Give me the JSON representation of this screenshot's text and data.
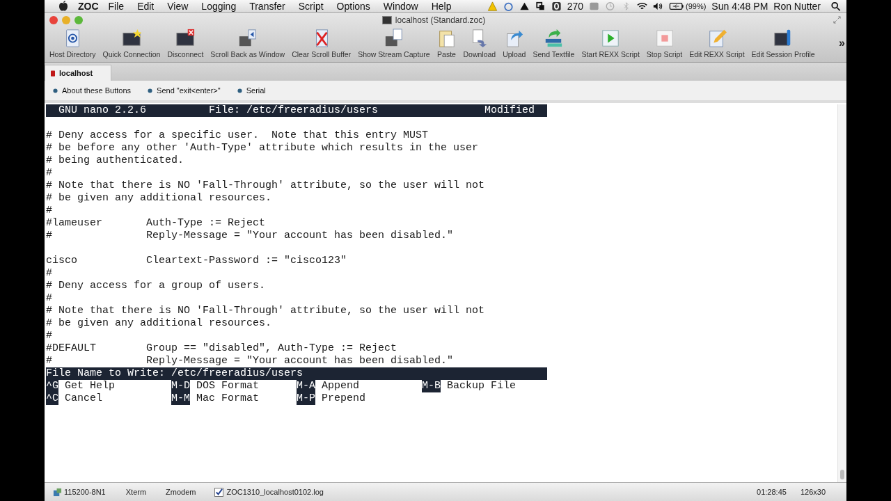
{
  "menu_bar": {
    "app": "ZOC",
    "menus": [
      "File",
      "Edit",
      "View",
      "Logging",
      "Transfer",
      "Script",
      "Options",
      "Window",
      "Help"
    ],
    "counter": "270",
    "battery": "(99%)",
    "clock": "Sun 4:48 PM",
    "user": "Ron Nutter"
  },
  "window": {
    "title": "localhost (Standard.zoc)"
  },
  "toolbar": [
    {
      "label": "Host Directory"
    },
    {
      "label": "Quick Connection"
    },
    {
      "label": "Disconnect"
    },
    {
      "label": "Scroll Back as Window"
    },
    {
      "label": "Clear Scroll Buffer"
    },
    {
      "label": "Show Stream Capture"
    },
    {
      "label": "Paste"
    },
    {
      "label": "Download"
    },
    {
      "label": "Upload"
    },
    {
      "label": "Send Textfile"
    },
    {
      "label": "Start REXX Script"
    },
    {
      "label": "Stop Script"
    },
    {
      "label": "Edit REXX Script"
    },
    {
      "label": "Edit Session Profile"
    }
  ],
  "toolbar_overflow": "»",
  "tabs": [
    {
      "label": "localhost",
      "selected": true
    }
  ],
  "user_buttons": [
    "About these Buttons",
    "Send \"exit<enter>\"",
    "Serial"
  ],
  "terminal": {
    "header": {
      "version": "GNU nano 2.2.6",
      "file": "File: /etc/freeradius/users",
      "status": "Modified"
    },
    "lines": [
      {
        "kind": "blank"
      },
      {
        "kind": "text",
        "text": "# Deny access for a specific user.  Note that this entry MUST"
      },
      {
        "kind": "text",
        "text": "# be before any other 'Auth-Type' attribute which results in the user"
      },
      {
        "kind": "text",
        "text": "# being authenticated."
      },
      {
        "kind": "text",
        "text": "#"
      },
      {
        "kind": "text",
        "text": "# Note that there is NO 'Fall-Through' attribute, so the user will not"
      },
      {
        "kind": "text",
        "text": "# be given any additional resources."
      },
      {
        "kind": "text",
        "text": "#"
      },
      {
        "kind": "text",
        "text": "#lameuser       Auth-Type := Reject"
      },
      {
        "kind": "text",
        "text": "#               Reply-Message = \"Your account has been disabled.\""
      },
      {
        "kind": "blank"
      },
      {
        "kind": "text",
        "text": "cisco           Cleartext-Password := \"cisco123\""
      },
      {
        "kind": "text",
        "text": "#"
      },
      {
        "kind": "text",
        "text": "# Deny access for a group of users."
      },
      {
        "kind": "text",
        "text": "#"
      },
      {
        "kind": "text",
        "text": "# Note that there is NO 'Fall-Through' attribute, so the user will not"
      },
      {
        "kind": "text",
        "text": "# be given any additional resources."
      },
      {
        "kind": "text",
        "text": "#"
      },
      {
        "kind": "text",
        "text": "#DEFAULT        Group == \"disabled\", Auth-Type := Reject"
      },
      {
        "kind": "text",
        "text": "#               Reply-Message = \"Your account has been disabled.\""
      }
    ],
    "prompt": "File Name to Write: /etc/freeradius/users",
    "shortcuts": [
      [
        {
          "key": "^G",
          "label": "Get Help"
        },
        {
          "key": "M-D",
          "label": "DOS Format"
        },
        {
          "key": "M-A",
          "label": "Append"
        },
        {
          "key": "M-B",
          "label": "Backup File"
        }
      ],
      [
        {
          "key": "^C",
          "label": "Cancel"
        },
        {
          "key": "M-M",
          "label": "Mac Format"
        },
        {
          "key": "M-P",
          "label": "Prepend"
        }
      ]
    ]
  },
  "status_bar": {
    "serial": "115200-8N1",
    "emulation": "Xterm",
    "transfer": "Zmodem",
    "log": {
      "label": "ZOC1310_localhost0102.log",
      "checked": true
    },
    "elapsed": "01:28:45",
    "size": "126x30"
  }
}
